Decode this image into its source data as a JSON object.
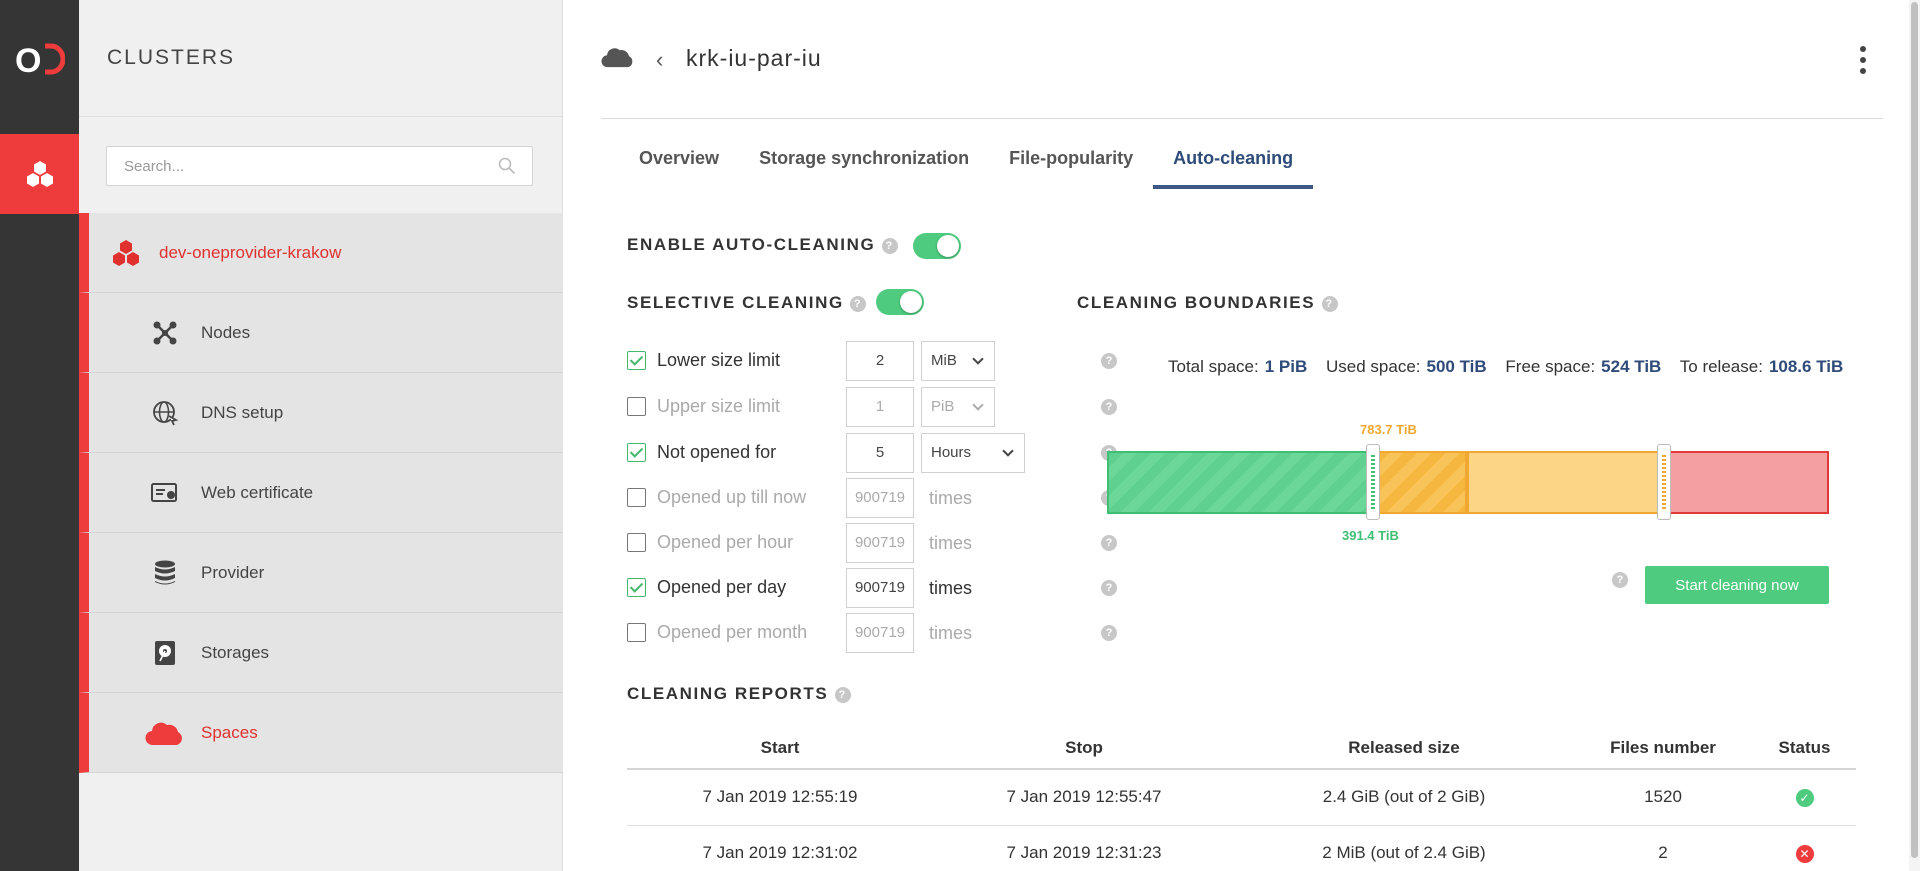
{
  "sidebar": {
    "header": "CLUSTERS",
    "search_placeholder": "Search...",
    "cluster": "dev-oneprovider-krakow",
    "items": [
      {
        "label": "Nodes",
        "icon": "nodes-icon"
      },
      {
        "label": "DNS setup",
        "icon": "globe-icon"
      },
      {
        "label": "Web certificate",
        "icon": "certificate-icon"
      },
      {
        "label": "Provider",
        "icon": "database-icon"
      },
      {
        "label": "Storages",
        "icon": "hard-drive-icon"
      },
      {
        "label": "Spaces",
        "icon": "cloud-icon"
      }
    ]
  },
  "header": {
    "title": "krk-iu-par-iu"
  },
  "tabs": [
    "Overview",
    "Storage synchronization",
    "File-popularity",
    "Auto-cleaning"
  ],
  "autoclean": {
    "enable_label": "ENABLE AUTO-CLEANING",
    "enabled": true,
    "selective_label": "SELECTIVE CLEANING",
    "selective_enabled": true,
    "rules": [
      {
        "label": "Lower size limit",
        "checked": true,
        "value": "2",
        "unit": "MiB"
      },
      {
        "label": "Upper size limit",
        "checked": false,
        "value": "1",
        "unit": "PiB"
      },
      {
        "label": "Not opened for",
        "checked": true,
        "value": "5",
        "unit": "Hours"
      },
      {
        "label": "Opened up till now",
        "checked": false,
        "value": "900719",
        "unit": "times"
      },
      {
        "label": "Opened per hour",
        "checked": false,
        "value": "900719",
        "unit": "times"
      },
      {
        "label": "Opened per day",
        "checked": true,
        "value": "900719",
        "unit": "times"
      },
      {
        "label": "Opened per month",
        "checked": false,
        "value": "900719",
        "unit": "times"
      }
    ]
  },
  "boundaries": {
    "title": "CLEANING BOUNDARIES",
    "total_label": "Total space:",
    "total": "1 PiB",
    "used_label": "Used space:",
    "used": "500 TiB",
    "free_label": "Free space:",
    "free": "524 TiB",
    "release_label": "To release:",
    "release": "108.6 TiB",
    "lower_threshold": "391.4 TiB",
    "upper_threshold": "783.7 TiB",
    "start_button": "Start cleaning now",
    "colors": {
      "green": "#5fd08f",
      "orange": "#f5b740",
      "yellow": "#fcd587",
      "red": "#f4a0a0"
    }
  },
  "reports": {
    "title": "CLEANING REPORTS",
    "columns": [
      "Start",
      "Stop",
      "Released size",
      "Files number",
      "Status"
    ],
    "rows": [
      {
        "start": "7 Jan 2019 12:55:19",
        "stop": "7 Jan 2019 12:55:47",
        "released": "2.4 GiB (out of 2 GiB)",
        "files": "1520",
        "status": "success"
      },
      {
        "start": "7 Jan 2019 12:31:02",
        "stop": "7 Jan 2019 12:31:23",
        "released": "2 MiB (out of 2.4 GiB)",
        "files": "2",
        "status": "failure"
      }
    ]
  }
}
